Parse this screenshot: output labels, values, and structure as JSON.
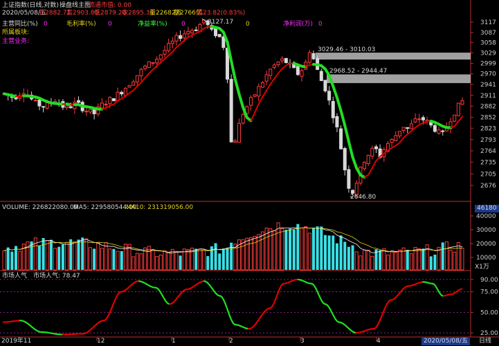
{
  "header": {
    "title": "上证指数(日线,对数)",
    "indicator_tab": "操盘线主图",
    "indicator_status": "流通市值: 0.00",
    "date_line": "2020/05/08/五",
    "open": "开2882.71",
    "high": "高2903.80",
    "low": "低2879.20",
    "close": "收2895.34",
    "volume": "量22682万",
    "amount": "额2766亿",
    "change": "幅23.82(0.83%)"
  },
  "fundamentals": {
    "row1": [
      {
        "label": "主营同比(%)",
        "value": "0"
      },
      {
        "label": "毛利率(%)",
        "value": "0"
      },
      {
        "label": "净益率(%)",
        "value": "0"
      },
      {
        "label": "净利润(万)",
        "value": "0"
      }
    ],
    "sector_label": "所属板块:",
    "business_label": "主营业务:"
  },
  "price_annotations": {
    "high": "3127.17",
    "low": "2646.80",
    "zone1": "3029.46 - 3010.03",
    "zone2": "2968.52 - 2944.47"
  },
  "volume_header": {
    "volume": "VOLUME: 226822080.00",
    "ma5": "MA5: 229580544.00",
    "ma10": "MA10: 231319056.00",
    "current": "46180",
    "unit": "X1万"
  },
  "popularity_header": {
    "name": "市场人气",
    "value": "市场人气: 78.47"
  },
  "footer": {
    "date_left": "2019年11",
    "month_12": "12",
    "month_1": "1",
    "month_2": "2",
    "month_3": "3",
    "month_4": "4",
    "date_right": "2020/05/08/五",
    "period": "日线"
  },
  "chart_data": {
    "type": "candlestick",
    "price_axis": {
      "ticks": [
        3117,
        3087,
        3058,
        3029,
        2999,
        2970,
        2941,
        2911,
        2882,
        2852,
        2823,
        2793,
        2764,
        2735,
        2705,
        2676
      ],
      "ylim": [
        2660,
        3130
      ]
    },
    "volume_axis": {
      "ticks": [
        40000,
        30000,
        20000,
        10000
      ],
      "ylim": [
        0,
        48000
      ]
    },
    "popularity_axis": {
      "ticks": [
        90.0,
        75.0,
        50.0,
        25.0
      ],
      "ylim": [
        20,
        100
      ]
    },
    "colors": {
      "up": "#ff3b3b",
      "down": "#39e0e6",
      "ma_up": "#e00000",
      "ma_down": "#22dd22",
      "ma5": "#ffffff",
      "ma10": "#e6d21a",
      "axis": "#c03030"
    }
  }
}
